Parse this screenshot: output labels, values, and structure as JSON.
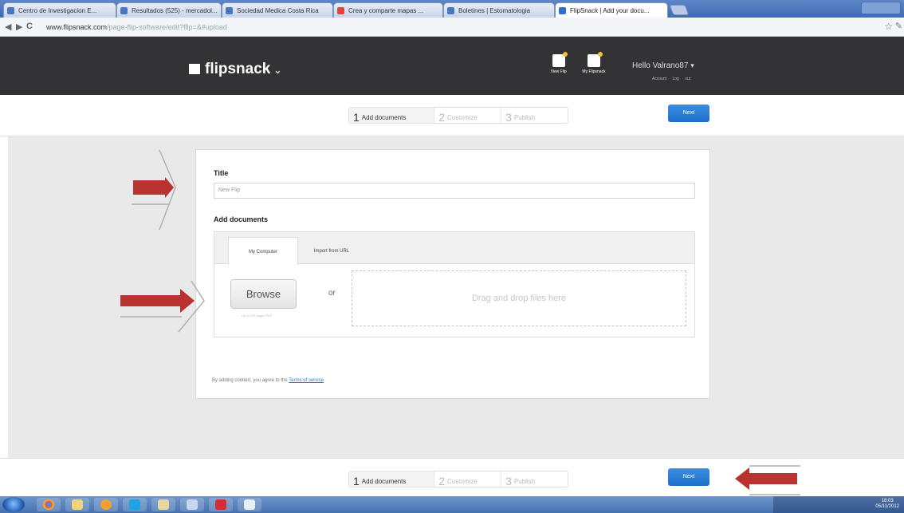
{
  "browser": {
    "tabs": [
      {
        "label": "Centro de Investigacion E..."
      },
      {
        "label": "Resultados (525) - mercadol..."
      },
      {
        "label": "Sociedad Medica Costa Rica"
      },
      {
        "label": "Crea y comparte mapas ..."
      },
      {
        "label": "Boletines | Estomatologia"
      },
      {
        "label": "FlipSnack | Add your docu..."
      }
    ],
    "url_host": "www.flipsnack.com",
    "url_path": "/page-flip-software/edit?flip=&#upload"
  },
  "header": {
    "logo_text": "flipsnack",
    "new_flip_label": "New Flip",
    "my_flipsnack_label": "My Flipsnack",
    "greeting": "Hello Valrano87",
    "account_link": "Account",
    "logout_link": "Log out"
  },
  "steps": [
    {
      "num": "1",
      "label": "Add documents"
    },
    {
      "num": "2",
      "label": "Customize"
    },
    {
      "num": "3",
      "label": "Publish"
    }
  ],
  "next_label": "Next",
  "form": {
    "title_label": "Title",
    "title_placeholder": "New Flip",
    "add_documents_label": "Add documents",
    "tab_computer": "My Computer",
    "tab_url": "Import from URL",
    "browse_label": "Browse",
    "browse_hint": "Up to 100 pages PDF",
    "or_label": "or",
    "drop_text": "Drag and drop files here",
    "terms_text": "By adding content, you agree to the",
    "terms_link": "Terms of service"
  },
  "taskbar": {
    "clock_time": "18:03",
    "clock_date": "05/11/2012"
  },
  "colors": {
    "header_bg": "#333336",
    "next_button": "#1d6ec9",
    "annotation_arrow": "#b8322f"
  }
}
